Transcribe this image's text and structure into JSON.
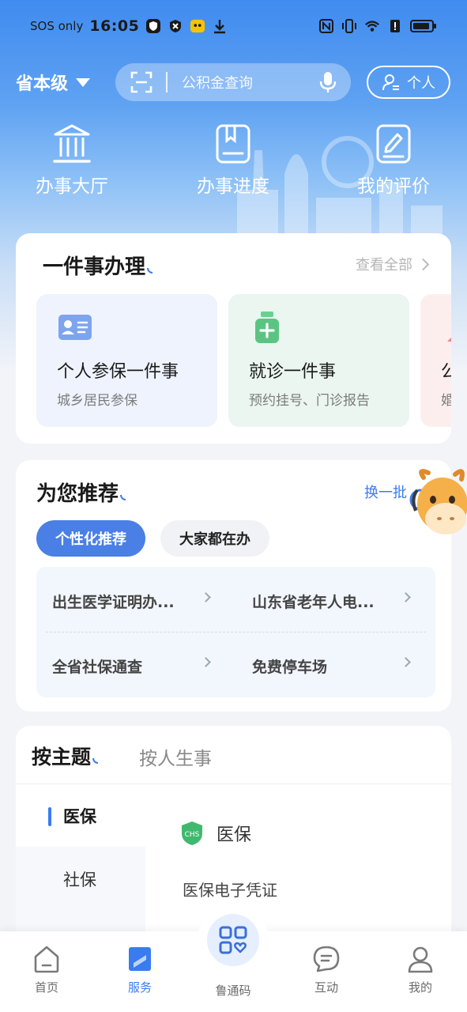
{
  "status_bar": {
    "sos": "SOS only",
    "time": "16:05"
  },
  "header": {
    "region": "省本级",
    "search_placeholder": "公积金查询",
    "personal": "个人"
  },
  "quick_actions": [
    {
      "label": "办事大厅",
      "icon": "building-icon"
    },
    {
      "label": "办事进度",
      "icon": "progress-book-icon"
    },
    {
      "label": "我的评价",
      "icon": "review-edit-icon"
    }
  ],
  "one_thing": {
    "title": "一件事办理",
    "see_all": "查看全部",
    "tiles": [
      {
        "title": "个人参保一件事",
        "subtitle": "城乡居民参保",
        "icon": "id-card-icon",
        "bg": "#eef3fd"
      },
      {
        "title": "就诊一件事",
        "subtitle": "预约挂号、门诊报告",
        "icon": "medicine-bottle-icon",
        "bg": "#eaf6ef"
      },
      {
        "title": "公",
        "subtitle": "婚",
        "icon": "person-icon",
        "bg": "#fdeeee"
      }
    ]
  },
  "recommend": {
    "title": "为您推荐",
    "refresh": "换一批",
    "tabs": [
      "个性化推荐",
      "大家都在办"
    ],
    "items": [
      "出生医学证明办...",
      "山东省老年人电...",
      "全省社保通查",
      "免费停车场"
    ]
  },
  "topics": {
    "tabs": [
      "按主题",
      "按人生事"
    ],
    "side_items": [
      "医保",
      "社保"
    ],
    "content_heading": "医保",
    "content_items": [
      "医保电子凭证"
    ]
  },
  "tabbar": {
    "items": [
      {
        "label": "首页",
        "icon": "home-icon"
      },
      {
        "label": "服务",
        "icon": "service-bookmark-icon"
      },
      {
        "label": "鲁通码",
        "icon": "qr-code-icon"
      },
      {
        "label": "互动",
        "icon": "chat-icon"
      },
      {
        "label": "我的",
        "icon": "profile-icon"
      }
    ],
    "active_index": 1
  },
  "colors": {
    "accent": "#3a7bf0",
    "pill_active": "#4a7fe5"
  }
}
